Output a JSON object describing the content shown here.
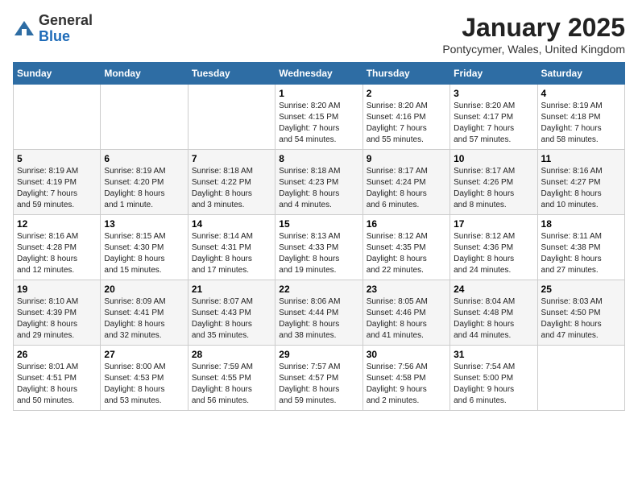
{
  "logo": {
    "general": "General",
    "blue": "Blue"
  },
  "title": "January 2025",
  "subtitle": "Pontycymer, Wales, United Kingdom",
  "days_of_week": [
    "Sunday",
    "Monday",
    "Tuesday",
    "Wednesday",
    "Thursday",
    "Friday",
    "Saturday"
  ],
  "weeks": [
    [
      {
        "day": "",
        "info": ""
      },
      {
        "day": "",
        "info": ""
      },
      {
        "day": "",
        "info": ""
      },
      {
        "day": "1",
        "info": "Sunrise: 8:20 AM\nSunset: 4:15 PM\nDaylight: 7 hours\nand 54 minutes."
      },
      {
        "day": "2",
        "info": "Sunrise: 8:20 AM\nSunset: 4:16 PM\nDaylight: 7 hours\nand 55 minutes."
      },
      {
        "day": "3",
        "info": "Sunrise: 8:20 AM\nSunset: 4:17 PM\nDaylight: 7 hours\nand 57 minutes."
      },
      {
        "day": "4",
        "info": "Sunrise: 8:19 AM\nSunset: 4:18 PM\nDaylight: 7 hours\nand 58 minutes."
      }
    ],
    [
      {
        "day": "5",
        "info": "Sunrise: 8:19 AM\nSunset: 4:19 PM\nDaylight: 7 hours\nand 59 minutes."
      },
      {
        "day": "6",
        "info": "Sunrise: 8:19 AM\nSunset: 4:20 PM\nDaylight: 8 hours\nand 1 minute."
      },
      {
        "day": "7",
        "info": "Sunrise: 8:18 AM\nSunset: 4:22 PM\nDaylight: 8 hours\nand 3 minutes."
      },
      {
        "day": "8",
        "info": "Sunrise: 8:18 AM\nSunset: 4:23 PM\nDaylight: 8 hours\nand 4 minutes."
      },
      {
        "day": "9",
        "info": "Sunrise: 8:17 AM\nSunset: 4:24 PM\nDaylight: 8 hours\nand 6 minutes."
      },
      {
        "day": "10",
        "info": "Sunrise: 8:17 AM\nSunset: 4:26 PM\nDaylight: 8 hours\nand 8 minutes."
      },
      {
        "day": "11",
        "info": "Sunrise: 8:16 AM\nSunset: 4:27 PM\nDaylight: 8 hours\nand 10 minutes."
      }
    ],
    [
      {
        "day": "12",
        "info": "Sunrise: 8:16 AM\nSunset: 4:28 PM\nDaylight: 8 hours\nand 12 minutes."
      },
      {
        "day": "13",
        "info": "Sunrise: 8:15 AM\nSunset: 4:30 PM\nDaylight: 8 hours\nand 15 minutes."
      },
      {
        "day": "14",
        "info": "Sunrise: 8:14 AM\nSunset: 4:31 PM\nDaylight: 8 hours\nand 17 minutes."
      },
      {
        "day": "15",
        "info": "Sunrise: 8:13 AM\nSunset: 4:33 PM\nDaylight: 8 hours\nand 19 minutes."
      },
      {
        "day": "16",
        "info": "Sunrise: 8:12 AM\nSunset: 4:35 PM\nDaylight: 8 hours\nand 22 minutes."
      },
      {
        "day": "17",
        "info": "Sunrise: 8:12 AM\nSunset: 4:36 PM\nDaylight: 8 hours\nand 24 minutes."
      },
      {
        "day": "18",
        "info": "Sunrise: 8:11 AM\nSunset: 4:38 PM\nDaylight: 8 hours\nand 27 minutes."
      }
    ],
    [
      {
        "day": "19",
        "info": "Sunrise: 8:10 AM\nSunset: 4:39 PM\nDaylight: 8 hours\nand 29 minutes."
      },
      {
        "day": "20",
        "info": "Sunrise: 8:09 AM\nSunset: 4:41 PM\nDaylight: 8 hours\nand 32 minutes."
      },
      {
        "day": "21",
        "info": "Sunrise: 8:07 AM\nSunset: 4:43 PM\nDaylight: 8 hours\nand 35 minutes."
      },
      {
        "day": "22",
        "info": "Sunrise: 8:06 AM\nSunset: 4:44 PM\nDaylight: 8 hours\nand 38 minutes."
      },
      {
        "day": "23",
        "info": "Sunrise: 8:05 AM\nSunset: 4:46 PM\nDaylight: 8 hours\nand 41 minutes."
      },
      {
        "day": "24",
        "info": "Sunrise: 8:04 AM\nSunset: 4:48 PM\nDaylight: 8 hours\nand 44 minutes."
      },
      {
        "day": "25",
        "info": "Sunrise: 8:03 AM\nSunset: 4:50 PM\nDaylight: 8 hours\nand 47 minutes."
      }
    ],
    [
      {
        "day": "26",
        "info": "Sunrise: 8:01 AM\nSunset: 4:51 PM\nDaylight: 8 hours\nand 50 minutes."
      },
      {
        "day": "27",
        "info": "Sunrise: 8:00 AM\nSunset: 4:53 PM\nDaylight: 8 hours\nand 53 minutes."
      },
      {
        "day": "28",
        "info": "Sunrise: 7:59 AM\nSunset: 4:55 PM\nDaylight: 8 hours\nand 56 minutes."
      },
      {
        "day": "29",
        "info": "Sunrise: 7:57 AM\nSunset: 4:57 PM\nDaylight: 8 hours\nand 59 minutes."
      },
      {
        "day": "30",
        "info": "Sunrise: 7:56 AM\nSunset: 4:58 PM\nDaylight: 9 hours\nand 2 minutes."
      },
      {
        "day": "31",
        "info": "Sunrise: 7:54 AM\nSunset: 5:00 PM\nDaylight: 9 hours\nand 6 minutes."
      },
      {
        "day": "",
        "info": ""
      }
    ]
  ]
}
